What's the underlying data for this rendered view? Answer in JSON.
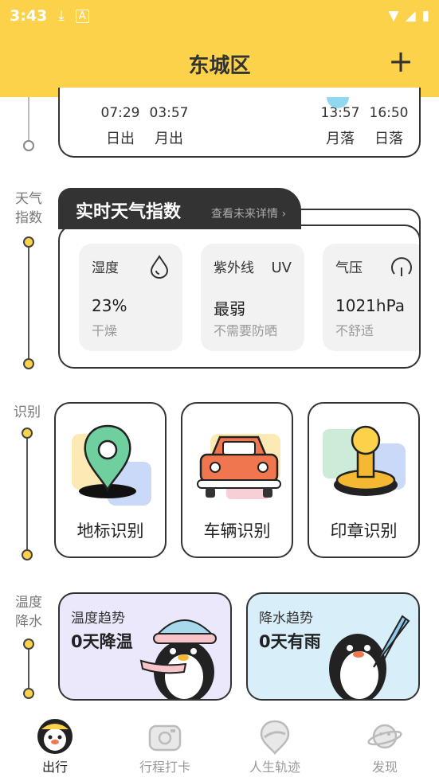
{
  "status": {
    "time": "3:43"
  },
  "header": {
    "title": "东城区",
    "add_label": "+"
  },
  "sun": {
    "sunrise": {
      "time": "07:29",
      "label": "日出"
    },
    "moonrise": {
      "time": "03:57",
      "label": "月出"
    },
    "moonset": {
      "time": "13:57",
      "label": "月落"
    },
    "sunset": {
      "time": "16:50",
      "label": "日落"
    }
  },
  "sections": {
    "weather": {
      "label_line1": "天气",
      "label_line2": "指数"
    },
    "recognition": {
      "label": "识别"
    },
    "trend": {
      "label_line1": "温度",
      "label_line2": "降水"
    }
  },
  "weather_index": {
    "title": "实时天气指数",
    "more": "查看未来详情 ›",
    "tiles": [
      {
        "name": "湿度",
        "value": "23%",
        "desc": "干燥",
        "icon": "water-drop-icon"
      },
      {
        "name": "紫外线",
        "value": "最弱",
        "desc": "不需要防晒",
        "icon_text": "UV",
        "icon": "uv-icon"
      },
      {
        "name": "气压",
        "value": "1021hPa",
        "desc": "不舒适",
        "icon": "pressure-gauge-icon"
      }
    ]
  },
  "recognition": {
    "items": [
      {
        "label": "地标识别",
        "icon": "map-pin-icon"
      },
      {
        "label": "车辆识别",
        "icon": "car-icon"
      },
      {
        "label": "印章识别",
        "icon": "stamp-icon"
      }
    ]
  },
  "trends": {
    "temperature": {
      "title": "温度趋势",
      "value": "0天降温",
      "icon": "penguin-scarf-icon"
    },
    "rain": {
      "title": "降水趋势",
      "value": "0天有雨",
      "icon": "penguin-umbrella-icon"
    }
  },
  "bottom_nav": [
    {
      "label": "出行",
      "icon": "penguin-icon",
      "active": true
    },
    {
      "label": "行程打卡",
      "icon": "camera-checkin-icon",
      "active": false
    },
    {
      "label": "人生轨迹",
      "icon": "track-pin-icon",
      "active": false
    },
    {
      "label": "发现",
      "icon": "planet-icon",
      "active": false
    }
  ],
  "colors": {
    "accent": "#fdd24b",
    "dark": "#333333",
    "muted": "#999999"
  }
}
